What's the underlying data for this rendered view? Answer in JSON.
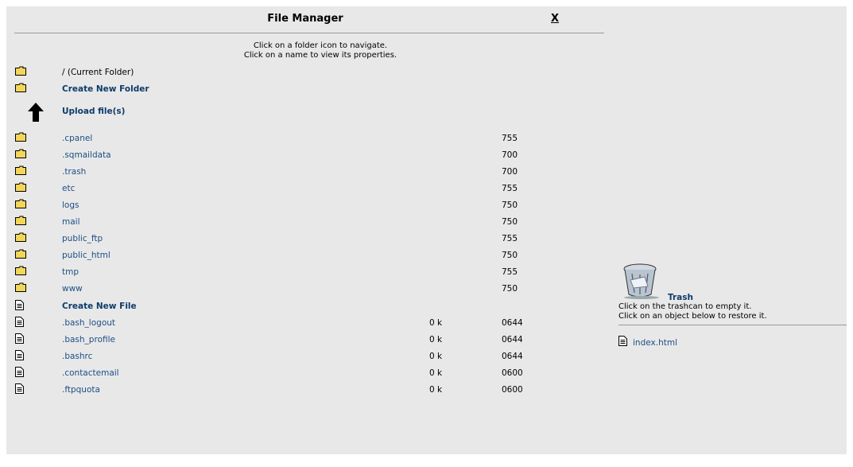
{
  "header": {
    "title": "File Manager",
    "close_label": "X"
  },
  "instructions": {
    "line1": "Click on a folder icon to navigate.",
    "line2": "Click on a name to view its properties."
  },
  "actions": {
    "current_folder": "/ (Current Folder)",
    "create_folder": "Create New Folder",
    "upload": "Upload file(s)",
    "create_file": "Create New File"
  },
  "folders": [
    {
      "name": ".cpanel",
      "perm": "755"
    },
    {
      "name": ".sqmaildata",
      "perm": "700"
    },
    {
      "name": ".trash",
      "perm": "700"
    },
    {
      "name": "etc",
      "perm": "755"
    },
    {
      "name": "logs",
      "perm": "750"
    },
    {
      "name": "mail",
      "perm": "750"
    },
    {
      "name": "public_ftp",
      "perm": "755"
    },
    {
      "name": "public_html",
      "perm": "750"
    },
    {
      "name": "tmp",
      "perm": "755"
    },
    {
      "name": "www",
      "perm": "750"
    }
  ],
  "files": [
    {
      "name": ".bash_logout",
      "size": "0 k",
      "perm": "0644"
    },
    {
      "name": ".bash_profile",
      "size": "0 k",
      "perm": "0644"
    },
    {
      "name": ".bashrc",
      "size": "0 k",
      "perm": "0644"
    },
    {
      "name": ".contactemail",
      "size": "0 k",
      "perm": "0600"
    },
    {
      "name": ".ftpquota",
      "size": "0 k",
      "perm": "0600"
    }
  ],
  "trash": {
    "title": "Trash",
    "help1": "Click on the trashcan to empty it.",
    "help2": "Click on an object below to restore it.",
    "items": [
      {
        "name": "index.html"
      }
    ]
  },
  "colors": {
    "background": "#e8e8e8",
    "link": "#1d4e86",
    "folder": "#f2d65a"
  }
}
